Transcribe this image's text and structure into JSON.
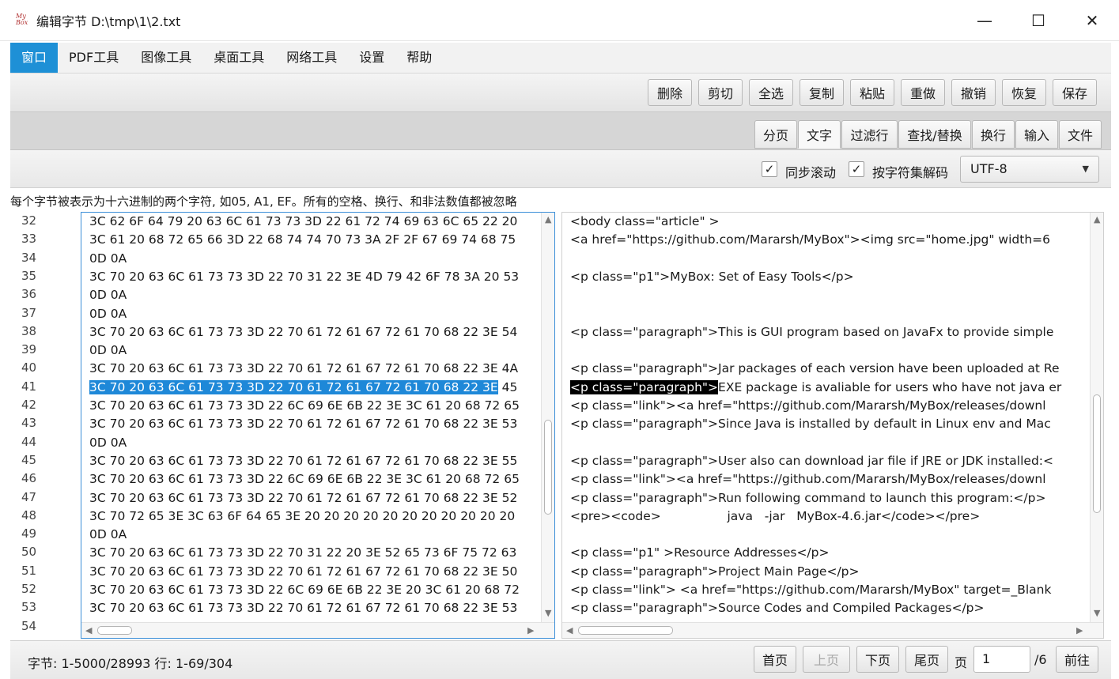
{
  "window": {
    "logo_text": "My Box",
    "title": "编辑字节  D:\\tmp\\1\\2.txt",
    "minimize_symbol": "—",
    "maximize_symbol": "☐",
    "close_symbol": "✕"
  },
  "menu": [
    "窗口",
    "PDF工具",
    "图像工具",
    "桌面工具",
    "网络工具",
    "设置",
    "帮助"
  ],
  "toolbar": [
    "删除",
    "剪切",
    "全选",
    "复制",
    "粘贴",
    "重做",
    "撤销",
    "恢复",
    "保存"
  ],
  "tabs": [
    "分页",
    "文字",
    "过滤行",
    "查找/替换",
    "换行",
    "输入",
    "文件"
  ],
  "selected_tab": "文字",
  "options": {
    "sync_scroll_label": "同步滚动",
    "sync_scroll_checked": true,
    "decode_label": "按字符集解码",
    "decode_checked": true,
    "charset": "UTF-8",
    "check_mark": "✓"
  },
  "description": "每个字节被表示为十六进制的两个字符, 如05, A1, EF。所有的空格、换行、和非法数值都被忽略",
  "line_numbers": [
    "32",
    "33",
    "34",
    "35",
    "36",
    "37",
    "38",
    "39",
    "40",
    "41",
    "42",
    "43",
    "44",
    "45",
    "46",
    "47",
    "48",
    "49",
    "50",
    "51",
    "52",
    "53",
    "54"
  ],
  "hex_lines": [
    "3C 62 6F 64 79 20 63 6C 61 73 73 3D 22 61 72 74 69 63 6C 65 22 20",
    "3C 61 20 68 72 65 66 3D 22 68 74 74 70 73 3A 2F 2F 67 69 74 68 75",
    "0D 0A",
    "3C 70 20 63 6C 61 73 73 3D 22 70 31 22 3E 4D 79 42 6F 78 3A 20 53",
    "0D 0A",
    "0D 0A",
    "3C 70 20 63 6C 61 73 73 3D 22 70 61 72 61 67 72 61 70 68 22 3E 54",
    "0D 0A",
    "3C 70 20 63 6C 61 73 73 3D 22 70 61 72 61 67 72 61 70 68 22 3E 4A",
    "3C 70 20 63 6C 61 73 73 3D 22 70 61 72 61 67 72 61 70 68 22 3E 45",
    "3C 70 20 63 6C 61 73 73 3D 22 6C 69 6E 6B 22 3E 3C 61 20 68 72 65",
    "3C 70 20 63 6C 61 73 73 3D 22 70 61 72 61 67 72 61 70 68 22 3E 53",
    "0D 0A",
    "3C 70 20 63 6C 61 73 73 3D 22 70 61 72 61 67 72 61 70 68 22 3E 55",
    "3C 70 20 63 6C 61 73 73 3D 22 6C 69 6E 6B 22 3E 3C 61 20 68 72 65",
    "3C 70 20 63 6C 61 73 73 3D 22 70 61 72 61 67 72 61 70 68 22 3E 52",
    "3C 70 72 65 3E 3C 63 6F 64 65 3E 20 20 20 20 20 20 20 20 20 20 20",
    "0D 0A",
    "3C 70 20 63 6C 61 73 73 3D 22 70 31 22 20 3E 52 65 73 6F 75 72 63",
    "3C 70 20 63 6C 61 73 73 3D 22 70 61 72 61 67 72 61 70 68 22 3E 50",
    "3C 70 20 63 6C 61 73 73 3D 22 6C 69 6E 6B 22 3E 20 3C 61 20 68 72",
    "3C 70 20 63 6C 61 73 73 3D 22 70 61 72 61 67 72 61 70 68 22 3E 53",
    ""
  ],
  "hex_selected_part": "3C 70 20 63 6C 61 73 73 3D 22 70 61 72 61 67 72 61 70 68 22 3E",
  "hex_selected_rest": " 45",
  "text_lines": [
    "<body class=\"article\" >",
    "<a href=\"https://github.com/Mararsh/MyBox\"><img src=\"home.jpg\" width=6",
    "",
    "<p class=\"p1\">MyBox: Set of Easy Tools</p>",
    "",
    "",
    "<p class=\"paragraph\">This is GUI program based on JavaFx to provide simple",
    "",
    "<p class=\"paragraph\">Jar packages of each version have been uploaded at Re",
    "",
    "<p class=\"link\"><a href=\"https://github.com/Mararsh/MyBox/releases/downl",
    "<p class=\"paragraph\">Since Java is installed by default in Linux env and Mac",
    "",
    "<p class=\"paragraph\">User also can download jar file if JRE or JDK installed:<",
    "<p class=\"link\"><a href=\"https://github.com/Mararsh/MyBox/releases/downl",
    "<p class=\"paragraph\">Run following command to launch this program:</p>",
    "<pre><code>                 java   -jar   MyBox-4.6.jar</code></pre>",
    "",
    "<p class=\"p1\" >Resource Addresses</p>",
    "<p class=\"paragraph\">Project Main Page</p>",
    "<p class=\"link\"> <a href=\"https://github.com/Mararsh/MyBox\" target=_Blank",
    "<p class=\"paragraph\">Source Codes and Compiled Packages</p>",
    ""
  ],
  "text_selected_part": "<p class=\"paragraph\">",
  "text_selected_rest": "EXE package is avaliable for users who have not java er",
  "status": "字节: 1-5000/28993 行: 1-69/304",
  "pagination": {
    "first": "首页",
    "prev": "上页",
    "next": "下页",
    "last": "尾页",
    "page_label": "页",
    "page_value": "1",
    "total": "/6",
    "go": "前往"
  },
  "colors": {
    "accent": "#1e90d6",
    "selection_hex": "#1e88d8",
    "selection_text": "#000000"
  }
}
